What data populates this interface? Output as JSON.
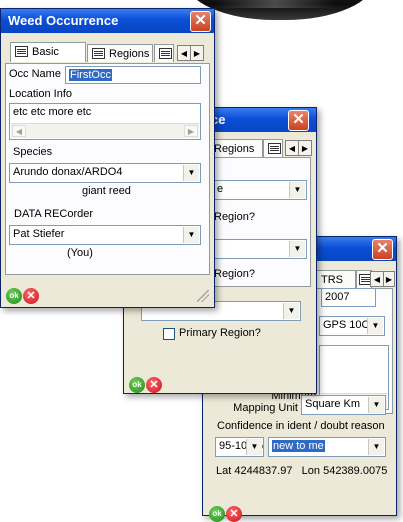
{
  "win1": {
    "title": "Weed Occurrence",
    "tabs": [
      "Basic",
      "Regions"
    ],
    "occ_name_label": "Occ Name",
    "occ_name_value": "FirstOcc",
    "location_label": "Location Info",
    "location_value": "etc etc more etc",
    "species_label": "Species",
    "species_value": "Arundo donax/ARDO4",
    "species_common": "giant reed",
    "recorder_label": "DATA RECorder",
    "recorder_value": "Pat Stiefer",
    "recorder_note": "(You)",
    "ok_label": "ok"
  },
  "win2": {
    "title_fragment": "ce",
    "tab_fragment": "Regions",
    "dd1_fragment": "e",
    "region_q1": "Region?",
    "region_q2": "Region?",
    "primary_region_label": "Primary Region?",
    "ok_label": "ok"
  },
  "win3": {
    "tab_fragment": "TRS",
    "year_value": "2007",
    "gps_value": "GPS 10C",
    "min_mapping_unit_label_1": "Minimum",
    "min_mapping_unit_label_2": "Mapping Unit",
    "min_mapping_unit_value": "Square Km",
    "confidence_label": "Confidence in ident / doubt reason",
    "confidence_value": "95-100%",
    "doubt_value": "new to me",
    "lat_label": "Lat",
    "lat_value": "4244837.97",
    "lon_label": "Lon",
    "lon_value": "542389.0075",
    "ok_label": "ok"
  },
  "icons": {
    "close": "close-icon",
    "ok": "ok-icon",
    "cancel": "cancel-icon",
    "tab": "table-icon"
  },
  "colors": {
    "titlebar": "#0a4fd6",
    "selection": "#316ac5",
    "ok": "#1f8a16",
    "cancel": "#c8111a"
  }
}
